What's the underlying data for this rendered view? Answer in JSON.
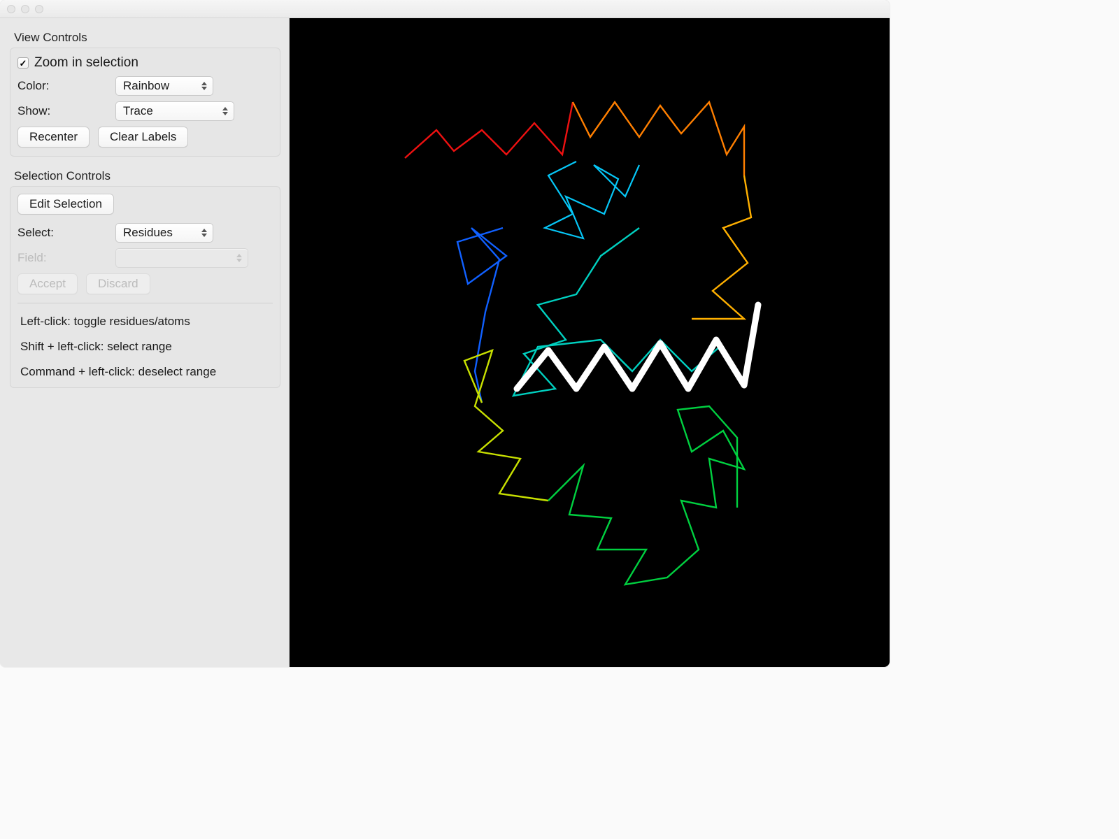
{
  "view_controls": {
    "title": "View Controls",
    "zoom_checkbox_label": "Zoom in selection",
    "zoom_checked": true,
    "color_label": "Color:",
    "color_value": "Rainbow",
    "show_label": "Show:",
    "show_value": "Trace",
    "recenter_label": "Recenter",
    "clear_labels_label": "Clear Labels"
  },
  "selection_controls": {
    "title": "Selection Controls",
    "edit_selection_label": "Edit Selection",
    "select_label": "Select:",
    "select_value": "Residues",
    "field_label": "Field:",
    "field_value": "",
    "accept_label": "Accept",
    "discard_label": "Discard",
    "help_lines": [
      "Left-click: toggle residues/atoms",
      "Shift + left-click: select range",
      "Command + left-click: deselect range"
    ]
  }
}
